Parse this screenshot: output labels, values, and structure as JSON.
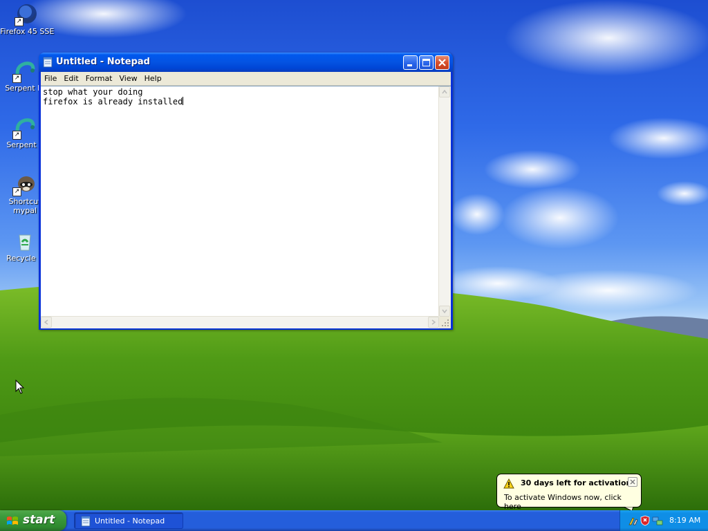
{
  "desktop": {
    "icons": [
      {
        "label": "Firefox 45 SSE",
        "icon": "firefox-icon"
      },
      {
        "label": "Serpent IA",
        "icon": "serpent-icon"
      },
      {
        "label": "Serpent x",
        "icon": "serpent-icon"
      },
      {
        "label_line1": "Shortcut",
        "label_line2": "mypal",
        "icon": "raccoon-icon"
      },
      {
        "label": "Recycle B",
        "icon": "recycle-bin-icon"
      }
    ]
  },
  "notepad": {
    "title": "Untitled - Notepad",
    "menu": [
      "File",
      "Edit",
      "Format",
      "View",
      "Help"
    ],
    "lines": [
      "stop what your doing",
      "firefox is already installed"
    ]
  },
  "taskbar": {
    "start_label": "start",
    "tasks": [
      {
        "label": "Untitled - Notepad",
        "icon": "notepad-icon"
      }
    ],
    "clock": "8:19 AM"
  },
  "balloon": {
    "title": "30 days left for activation",
    "text": "To activate Windows now, click here"
  },
  "colors": {
    "xp_blue": "#0058ee",
    "start_green": "#3c9a3c",
    "tray_blue": "#0f8ee6",
    "balloon_bg": "#ffffe1"
  }
}
